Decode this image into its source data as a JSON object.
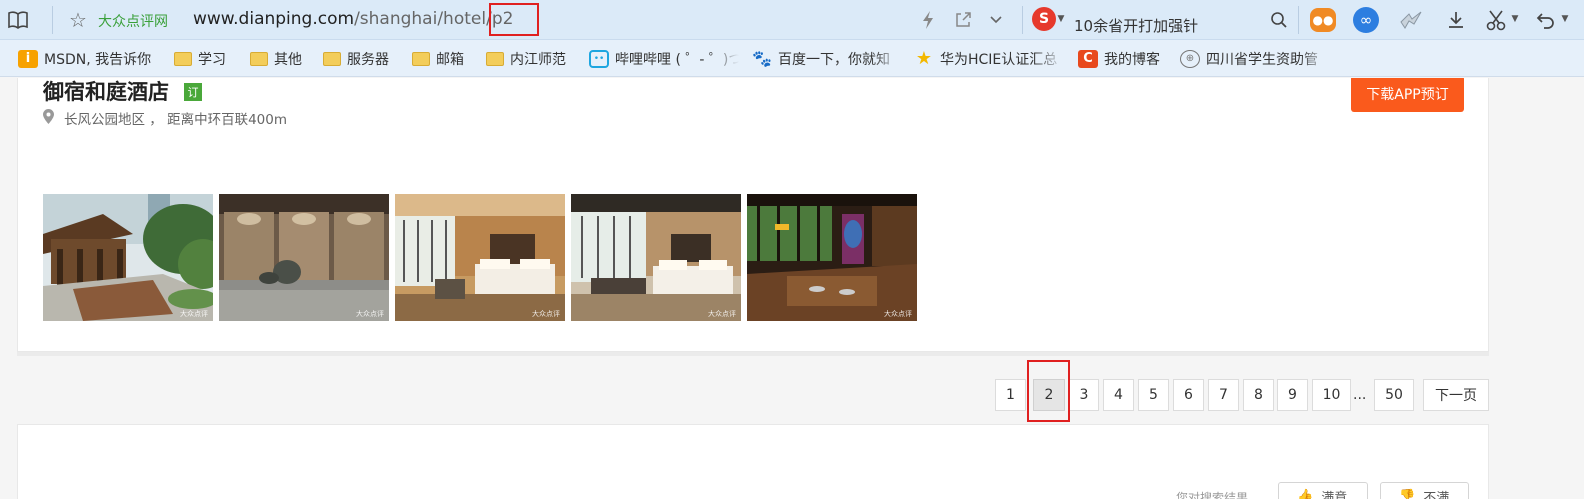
{
  "address_bar": {
    "site_name": "大众点评网",
    "url_host": "www.dianping.com",
    "url_path": "/shanghai/hotel/",
    "url_page": "p2",
    "news_text": "10余省开打加强针",
    "icons": [
      "reader-mode-icon",
      "favorite-star-icon",
      "lightning-icon",
      "share-icon",
      "chevron-down-icon",
      "sogou-icon",
      "search-icon",
      "game-icon",
      "infinity-icon",
      "bird-icon",
      "download-icon",
      "scissors-icon",
      "undo-icon"
    ]
  },
  "bookmarks": [
    {
      "label": "MSDN, 我告诉你",
      "icon": "msdn-icon"
    },
    {
      "label": "学习",
      "icon": "folder-icon"
    },
    {
      "label": "其他",
      "icon": "folder-icon"
    },
    {
      "label": "服务器",
      "icon": "folder-icon"
    },
    {
      "label": "邮箱",
      "icon": "folder-icon"
    },
    {
      "label": "内江师范",
      "icon": "folder-icon"
    },
    {
      "label": "哔哩哔哩 ( ゜- ゜)つ",
      "icon": "bilibili-icon"
    },
    {
      "label": "百度一下，你就知",
      "icon": "baidu-icon"
    },
    {
      "label": "华为HCIE认证汇总",
      "icon": "huawei-icon"
    },
    {
      "label": "我的博客",
      "icon": "csdn-icon"
    },
    {
      "label": "四川省学生资助管",
      "icon": "globe-icon"
    }
  ],
  "hotel": {
    "name": "御宿和庭酒店",
    "badge": "订",
    "address": "长风公园地区 ， 距离中环百联400m",
    "app_button": "下载APP预订",
    "photo_watermark": "大众点评",
    "photos": [
      "courtyard-exterior-photo",
      "lobby-stone-photo",
      "bedroom-photo",
      "bedroom-window-photo",
      "restaurant-photo"
    ]
  },
  "pagination": {
    "pages": [
      "1",
      "2",
      "3",
      "4",
      "5",
      "6",
      "7",
      "8",
      "9",
      "10"
    ],
    "current": "2",
    "ellipsis": "...",
    "last": "50",
    "next": "下一页"
  },
  "feedback": {
    "question": "您对搜索结果",
    "satisfied": "满意",
    "unsatisfied": "不满"
  },
  "colors": {
    "addr_bg": "#dbeaf8",
    "bookmark_bg": "#e6f0fa",
    "site_green": "#3aa03a",
    "accent_orange": "#fa5a1c",
    "highlight_red": "#e02020"
  }
}
